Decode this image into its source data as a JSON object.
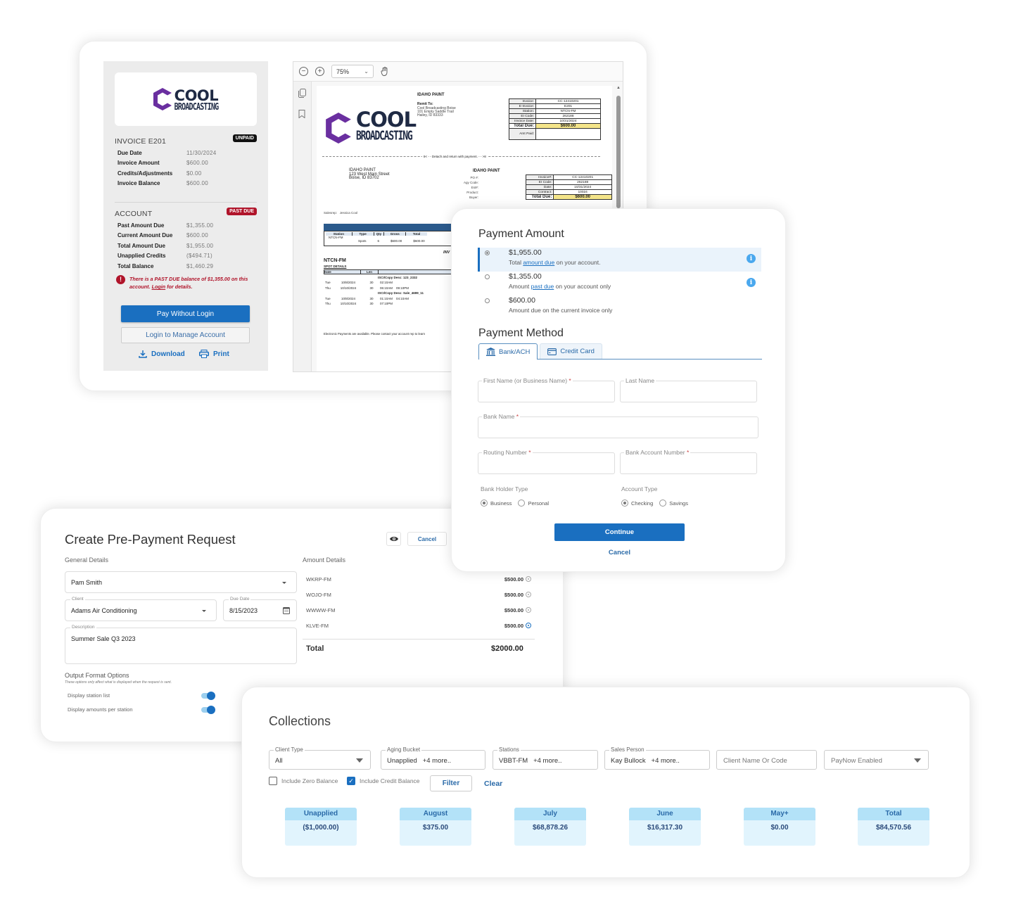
{
  "invoice_portal": {
    "logo": {
      "line1": "COOL",
      "line2": "BROADCASTING",
      "brand_color": "#6a2fa0",
      "text_color": "#1f2a44"
    },
    "invoice": {
      "title": "INVOICE E201",
      "status_badge": "UNPAID",
      "rows": [
        {
          "label": "Due Date",
          "value": "11/30/2024"
        },
        {
          "label": "Invoice Amount",
          "value": "$600.00"
        },
        {
          "label": "Credits/Adjustments",
          "value": "$0.00"
        },
        {
          "label": "Invoice Balance",
          "value": "$600.00"
        }
      ]
    },
    "account": {
      "title": "ACCOUNT",
      "status_badge": "PAST DUE",
      "rows": [
        {
          "label": "Past Amount Due",
          "value": "$1,355.00"
        },
        {
          "label": "Current Amount Due",
          "value": "$600.00"
        },
        {
          "label": "Total Amount Due",
          "value": "$1,955.00"
        },
        {
          "label": "Unapplied Credits",
          "value": "($494.71)"
        },
        {
          "label": "Total Balance",
          "value": "$1,460.29"
        }
      ],
      "warning_prefix": "There is a PAST DUE balance of $1,355.00 on this account. ",
      "warning_link": "Login",
      "warning_suffix": " for details."
    },
    "buttons": {
      "pay": "Pay Without Login",
      "login": "Login to Manage Account",
      "download": "Download",
      "print": "Print"
    },
    "pdf_viewer": {
      "zoom_level": "75%",
      "page": {
        "customer": "IDAHO PAINT",
        "remit_label": "Remit To:",
        "remit_lines": [
          "Cool Broadcasting Boise",
          "101 Empty Saddle Trail",
          "Hailey, ID 83333"
        ],
        "header_table": [
          {
            "label": "Invoice:",
            "value": "CC-12410201"
          },
          {
            "label": "E-Invoice:",
            "value": "E201"
          },
          {
            "label": "Station:",
            "value": "NTCN-FM"
          },
          {
            "label": "EI Code:",
            "value": "262188"
          },
          {
            "label": "Invoice Date:",
            "value": "10/31/2024"
          }
        ],
        "total_due_label": "Total Due:",
        "total_due_value": "$600.00",
        "amt_paid_label": "Amt Paid:",
        "detach_text": "8< - - Detach and return with payment. - - >8",
        "bill_to_lines": [
          "IDAHO PAINT",
          "123 West Main Street",
          "Boise, ID 83702"
        ],
        "customer_center": "IDAHO PAINT",
        "meta_labels": [
          "PO #:",
          "Agy Code:",
          "Est#:",
          "Product:",
          "Buyer:"
        ],
        "stub_table": [
          {
            "label": "Invoice#:",
            "value": "CC-12410201"
          },
          {
            "label": "EI Code:",
            "value": "262188"
          },
          {
            "label": "Date:",
            "value": "10/31/2024"
          },
          {
            "label": "Contract:",
            "value": "10024"
          }
        ],
        "salesrep_label": "Salesrep:",
        "salesrep": "Jessica Cool",
        "invoice_banner": "INVO",
        "line_headers": [
          "Station",
          "Type",
          "Qty",
          "Gross",
          "Total"
        ],
        "line_items": [
          {
            "station": "NTCN-FM",
            "type": "Spots",
            "qty": "6",
            "gross": "$600.00",
            "total": "$600.00"
          }
        ],
        "inv_label": "INV",
        "station_heading": "NTCN-FM",
        "spot_details_label": "SPOT DETAILS",
        "spot_headers": [
          "Date",
          "Len",
          "Time"
        ],
        "spot_groups": [
          {
            "isci": "ISCI/Copy Desc: 123_2332",
            "rows": [
              {
                "day": "Tue",
                "date": "10/8/2024",
                "len": "30",
                "times": "02:10AM"
              },
              {
                "day": "Thu",
                "date": "10/10/2024",
                "len": "30",
                "times": "06:10AM    09:10PM"
              }
            ]
          },
          {
            "isci": "ISCI/Copy Desc: Sale_4699_11",
            "rows": [
              {
                "day": "Tue",
                "date": "10/8/2024",
                "len": "30",
                "times": "01:10AM    04:10AM"
              },
              {
                "day": "Thu",
                "date": "10/10/2024",
                "len": "30",
                "times": "07:10PM"
              }
            ]
          }
        ],
        "footer_note": "Electronic Payments are available.  Please contact your account rep to learn"
      }
    }
  },
  "payment_form": {
    "amount_title": "Payment Amount",
    "options": [
      {
        "amount": "$1,955.00",
        "pre": "Total ",
        "link": "amount due",
        "post": " on your account.",
        "selected": true,
        "info": true
      },
      {
        "amount": "$1,355.00",
        "pre": "Amount ",
        "link": "past due",
        "post": " on your account only",
        "selected": false,
        "info": true
      },
      {
        "amount": "$600.00",
        "pre": "Amount due on the current invoice only",
        "link": "",
        "post": "",
        "selected": false,
        "info": false
      }
    ],
    "method_title": "Payment Method",
    "tabs": [
      {
        "label": "Bank/ACH",
        "active": true
      },
      {
        "label": "Credit Card",
        "active": false
      }
    ],
    "fields": {
      "first_name": {
        "label": "First Name (or Business Name)",
        "required": true,
        "value": ""
      },
      "last_name": {
        "label": "Last Name",
        "required": false,
        "value": ""
      },
      "bank_name": {
        "label": "Bank Name",
        "required": true,
        "value": ""
      },
      "routing": {
        "label": "Routing Number",
        "required": true,
        "value": ""
      },
      "account_number": {
        "label": "Bank Account Number",
        "required": true,
        "value": ""
      }
    },
    "holder_type": {
      "label": "Bank Holder Type",
      "options": [
        "Business",
        "Personal"
      ],
      "selected": "Business"
    },
    "account_type": {
      "label": "Account Type",
      "options": [
        "Checking",
        "Savings"
      ],
      "selected": "Checking"
    },
    "continue": "Continue",
    "cancel": "Cancel",
    "required_marker": "*"
  },
  "prepayment": {
    "title": "Create Pre-Payment Request",
    "cancel": "Cancel",
    "general_label": "General Details",
    "salesperson": "Pam Smith",
    "client_label": "Client",
    "client": "Adams Air Conditioning",
    "due_date_label": "Due Date",
    "due_date": "8/15/2023",
    "description_label": "Description",
    "description": "Summer Sale Q3 2023",
    "output_title": "Output Format Options",
    "output_note": "These options only affect what is displayed when the request is sent.",
    "toggles": [
      {
        "label": "Display station list",
        "on": true
      },
      {
        "label": "Display amounts per station",
        "on": true
      }
    ],
    "amount_label": "Amount Details",
    "stations": [
      {
        "name": "WKRP-FM",
        "amount": "$500.00",
        "active": false
      },
      {
        "name": "WOJO-FM",
        "amount": "$500.00",
        "active": false
      },
      {
        "name": "WWWW-FM",
        "amount": "$500.00",
        "active": false
      },
      {
        "name": "KLVE-FM",
        "amount": "$500.00",
        "active": true
      }
    ],
    "total_label": "Total",
    "total": "$2000.00"
  },
  "collections": {
    "title": "Collections",
    "filters": {
      "client_type": {
        "label": "Client Type",
        "value": "All"
      },
      "aging_bucket": {
        "label": "Aging Bucket",
        "value": "Unapplied   +4 more.."
      },
      "stations": {
        "label": "Stations",
        "value": "VBBT-FM   +4 more.."
      },
      "sales_person": {
        "label": "Sales Person",
        "value": "Kay Bullock   +4 more.."
      },
      "client_search": {
        "placeholder": "Client Name Or Code",
        "value": ""
      },
      "paynow": {
        "value": "PayNow Enabled"
      }
    },
    "include_zero": {
      "label": "Include Zero Balance",
      "checked": false
    },
    "include_credit": {
      "label": "Include Credit Balance",
      "checked": true
    },
    "filter_button": "Filter",
    "clear_link": "Clear",
    "buckets": [
      {
        "label": "Unapplied",
        "value": "($1,000.00)"
      },
      {
        "label": "August",
        "value": "$375.00"
      },
      {
        "label": "July",
        "value": "$68,878.26"
      },
      {
        "label": "June",
        "value": "$16,317.30"
      },
      {
        "label": "May+",
        "value": "$0.00"
      },
      {
        "label": "Total",
        "value": "$84,570.56"
      }
    ]
  }
}
